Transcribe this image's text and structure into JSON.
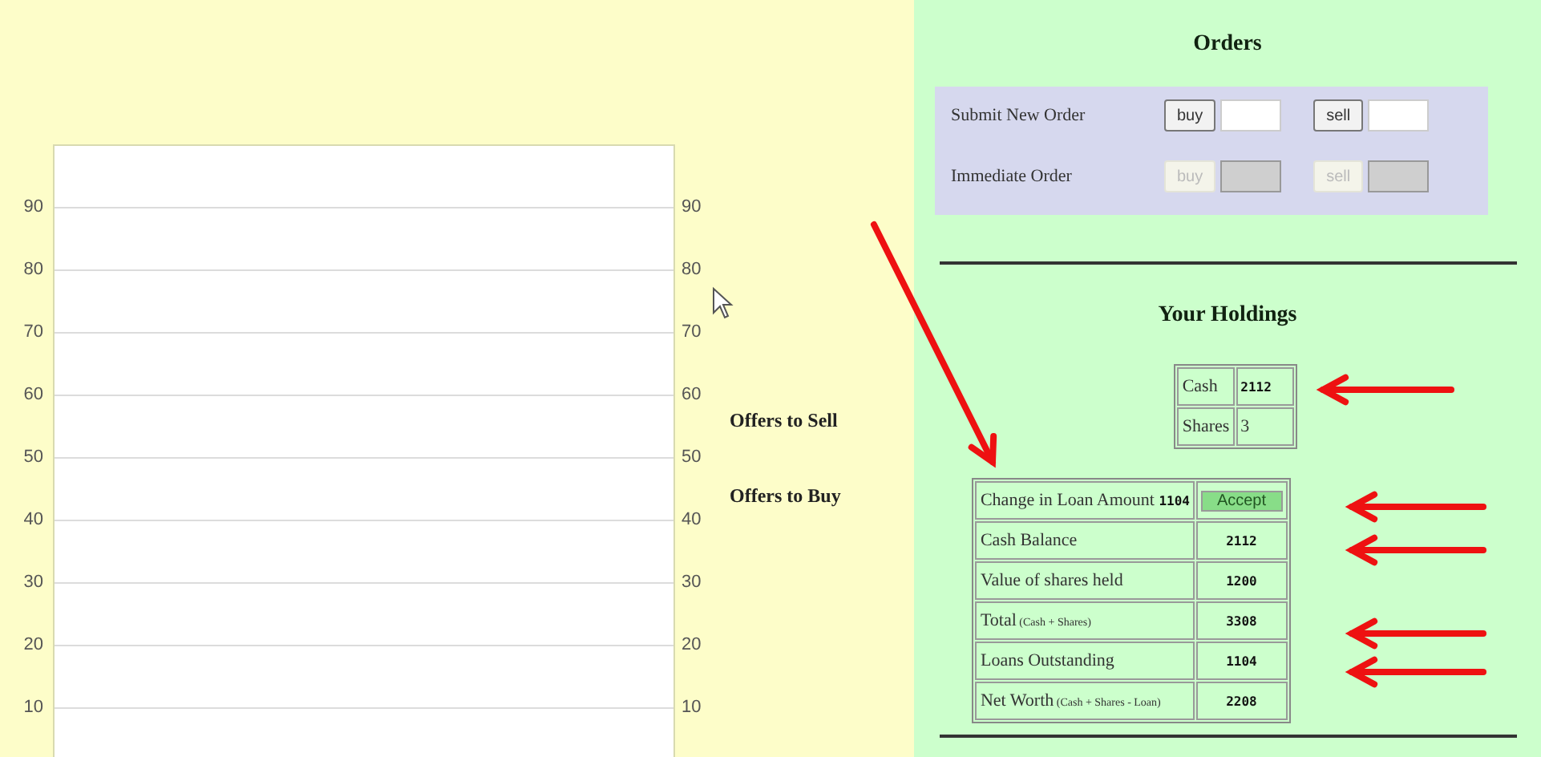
{
  "chart": {
    "left_ticks": [
      "90",
      "80",
      "70",
      "60",
      "50",
      "40",
      "30",
      "20",
      "10"
    ],
    "right_ticks": [
      "90",
      "80",
      "70",
      "60",
      "50",
      "40",
      "30",
      "20",
      "10"
    ],
    "legend": [
      "Offers to Sell",
      "Offers to Buy"
    ]
  },
  "orders": {
    "title": "Orders",
    "rows": [
      {
        "label": "Submit New Order",
        "buy": "buy",
        "sell": "sell",
        "disabled": false
      },
      {
        "label": "Immediate Order",
        "buy": "buy",
        "sell": "sell",
        "disabled": true
      }
    ]
  },
  "holdings": {
    "title": "Your Holdings",
    "rows": [
      {
        "label": "Cash",
        "value": "2112",
        "kind": "mono"
      },
      {
        "label": "Shares",
        "value": "3",
        "kind": "plain"
      }
    ]
  },
  "summary": [
    {
      "kind": "action",
      "label": "Change in Loan Amount",
      "amount": "1104",
      "button": "Accept"
    },
    {
      "kind": "value",
      "label": "Cash Balance",
      "value": "2112"
    },
    {
      "kind": "value",
      "label": "Value of shares held",
      "value": "1200"
    },
    {
      "kind": "value",
      "label": "Total",
      "note": "(Cash + Shares)",
      "value": "3308"
    },
    {
      "kind": "value",
      "label": "Loans Outstanding",
      "value": "1104"
    },
    {
      "kind": "value",
      "label": "Net Worth",
      "note": "(Cash + Shares - Loan)",
      "value": "2208"
    }
  ]
}
